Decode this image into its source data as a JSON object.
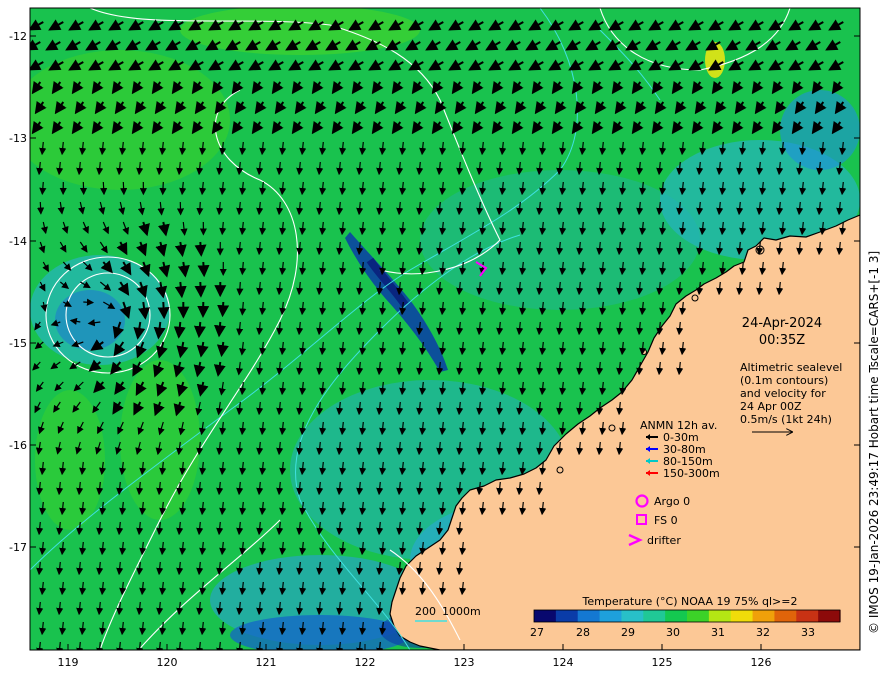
{
  "map": {
    "date": "24-Apr-2024",
    "time": "00:35Z",
    "altimetry_note": [
      "Altimetric sealevel",
      "(0.1m contours)",
      "and velocity for",
      "24 Apr 00Z",
      "0.5m/s (1kt 24h)"
    ],
    "side_caption": "© IMOS 19-Jan-2026 23:49:17 Hobart time Tscale=CARS+[-1 3]",
    "lat_ticks": [
      "-12",
      "-13",
      "-14",
      "-15",
      "-16",
      "-17"
    ],
    "lon_ticks": [
      "119",
      "120",
      "121",
      "122",
      "123",
      "124",
      "125",
      "126"
    ],
    "anmn": {
      "title": "ANMN 12h av.",
      "items": [
        {
          "label": "0-30m",
          "color": "#000000"
        },
        {
          "label": "30-80m",
          "color": "#0000ff"
        },
        {
          "label": "80-150m",
          "color": "#00c8c8"
        },
        {
          "label": "150-300m",
          "color": "#ff0000"
        }
      ]
    },
    "platforms": {
      "argo": "Argo 0",
      "fs": "FS 0",
      "drifter": "drifter",
      "color": "#ff00ff"
    },
    "depth_legend": {
      "a": "200",
      "b": "1000m"
    },
    "colorbar": {
      "title": "Temperature (°C) NOAA 19 75% ql>=2",
      "ticks": [
        "27",
        "28",
        "29",
        "30",
        "31",
        "32",
        "33"
      ],
      "colors": [
        "#08086e",
        "#0a3ca8",
        "#1478d2",
        "#1ea0dc",
        "#28c0c8",
        "#20c896",
        "#14c850",
        "#3cd228",
        "#b4e614",
        "#f0dc0a",
        "#f0a00a",
        "#e0640a",
        "#c83214",
        "#8c0a0a"
      ]
    },
    "colors": {
      "land": "#fcc896",
      "sea_base": "#19c24e",
      "contour": "#ffffff",
      "bathy": "#40e0e0",
      "arrow": "#000000"
    }
  }
}
